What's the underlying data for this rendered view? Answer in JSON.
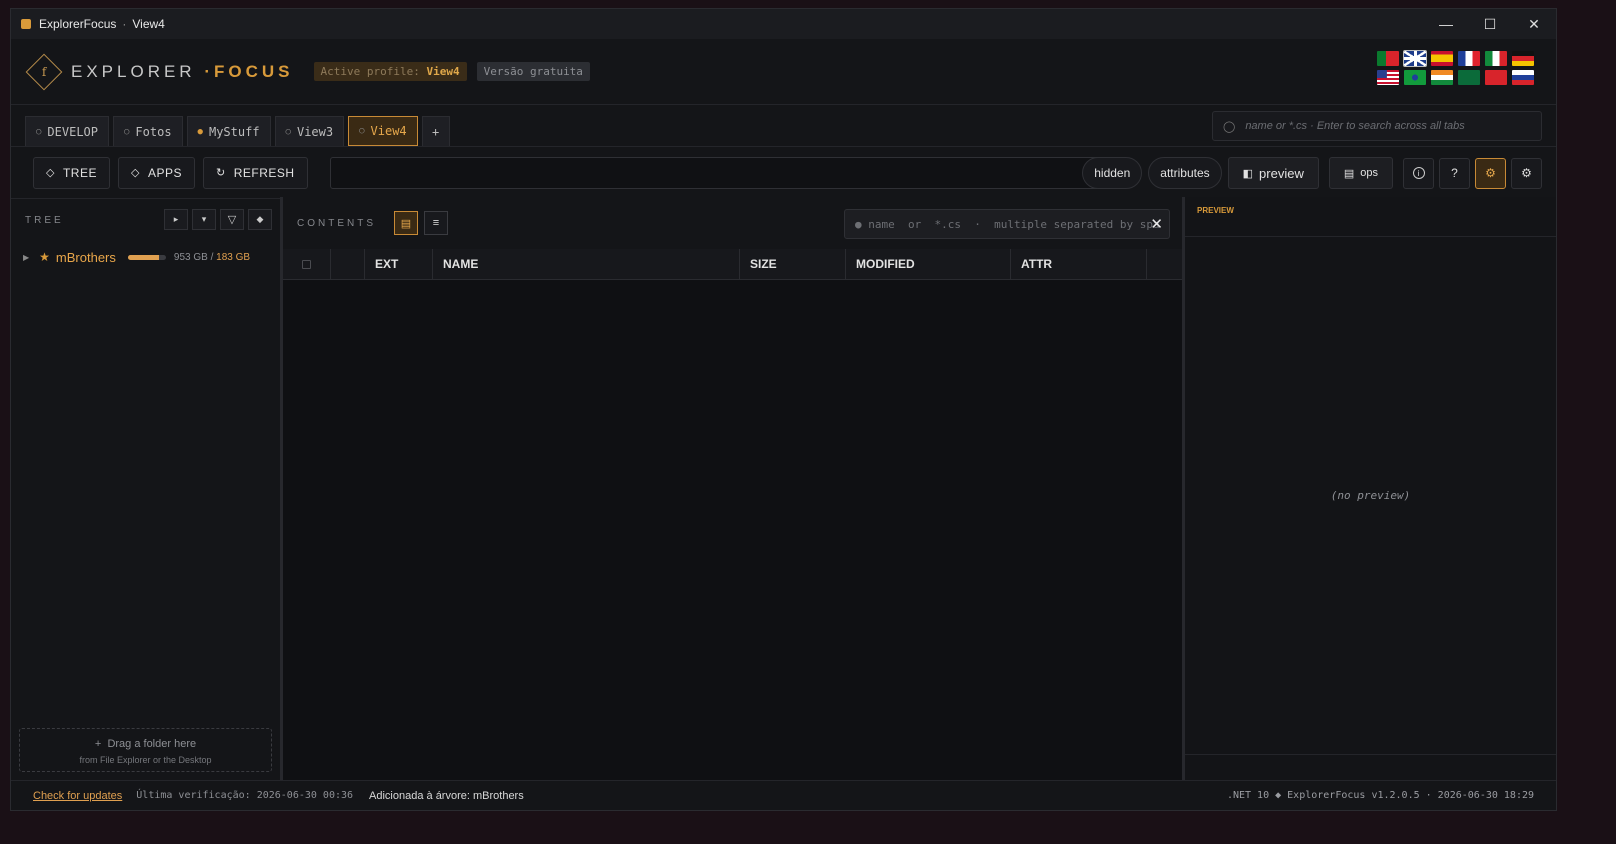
{
  "window": {
    "app": "ExplorerFocus",
    "view": "View4"
  },
  "header": {
    "brand_main": "EXPLORER",
    "brand_dot": "·",
    "brand_accent": "FOCUS",
    "logo_letter": "f",
    "profile_label": "Active profile:",
    "profile_name": "View4",
    "edition": "Versão gratuita",
    "flags": [
      "pt",
      "gb",
      "es",
      "fr",
      "it",
      "de",
      "us",
      "br",
      "in",
      "sa",
      "cn",
      "ru"
    ],
    "selected_flag": "gb"
  },
  "tabs": [
    {
      "label": "DEVELOP",
      "dot": "○"
    },
    {
      "label": "Fotos",
      "dot": "○"
    },
    {
      "label": "MyStuff",
      "dot": "●"
    },
    {
      "label": "View3",
      "dot": "○"
    },
    {
      "label": "View4",
      "dot": "○"
    }
  ],
  "tab_add": "+",
  "global_search": {
    "placeholder": "name or *.cs  ·  Enter to search across all tabs"
  },
  "toolbar": {
    "tree": "TREE",
    "apps": "APPS",
    "refresh": "REFRESH",
    "hidden": "hidden",
    "attributes": "attributes",
    "preview": "preview",
    "ops": "ops",
    "info": "i",
    "help": "?"
  },
  "tree": {
    "label": "TREE",
    "items": [
      {
        "name": "mBrothers",
        "size_total": "953 GB",
        "size_free": "183 GB",
        "usage": 0.81
      }
    ],
    "drop_line1": "Drag a folder here",
    "drop_line2": "from File Explorer or the Desktop"
  },
  "contents": {
    "label": "CONTENTS",
    "search_placeholder": "name  or  *.cs  ·  multiple separated by spa",
    "columns": [
      "EXT",
      "NAME",
      "SIZE",
      "MODIFIED",
      "ATTR"
    ]
  },
  "preview": {
    "label": "PREVIEW",
    "empty": "(no preview)"
  },
  "status": {
    "check_updates": "Check for updates",
    "last_check": "Última verificação: 2026-06-30 00:36",
    "message": "Adicionada à árvore: mBrothers",
    "right": ".NET 10  ◆ ExplorerFocus  v1.2.0.5  ·  2026-06-30  18:29"
  },
  "colors": {
    "accent": "#d89a3a",
    "background": "#141518"
  }
}
